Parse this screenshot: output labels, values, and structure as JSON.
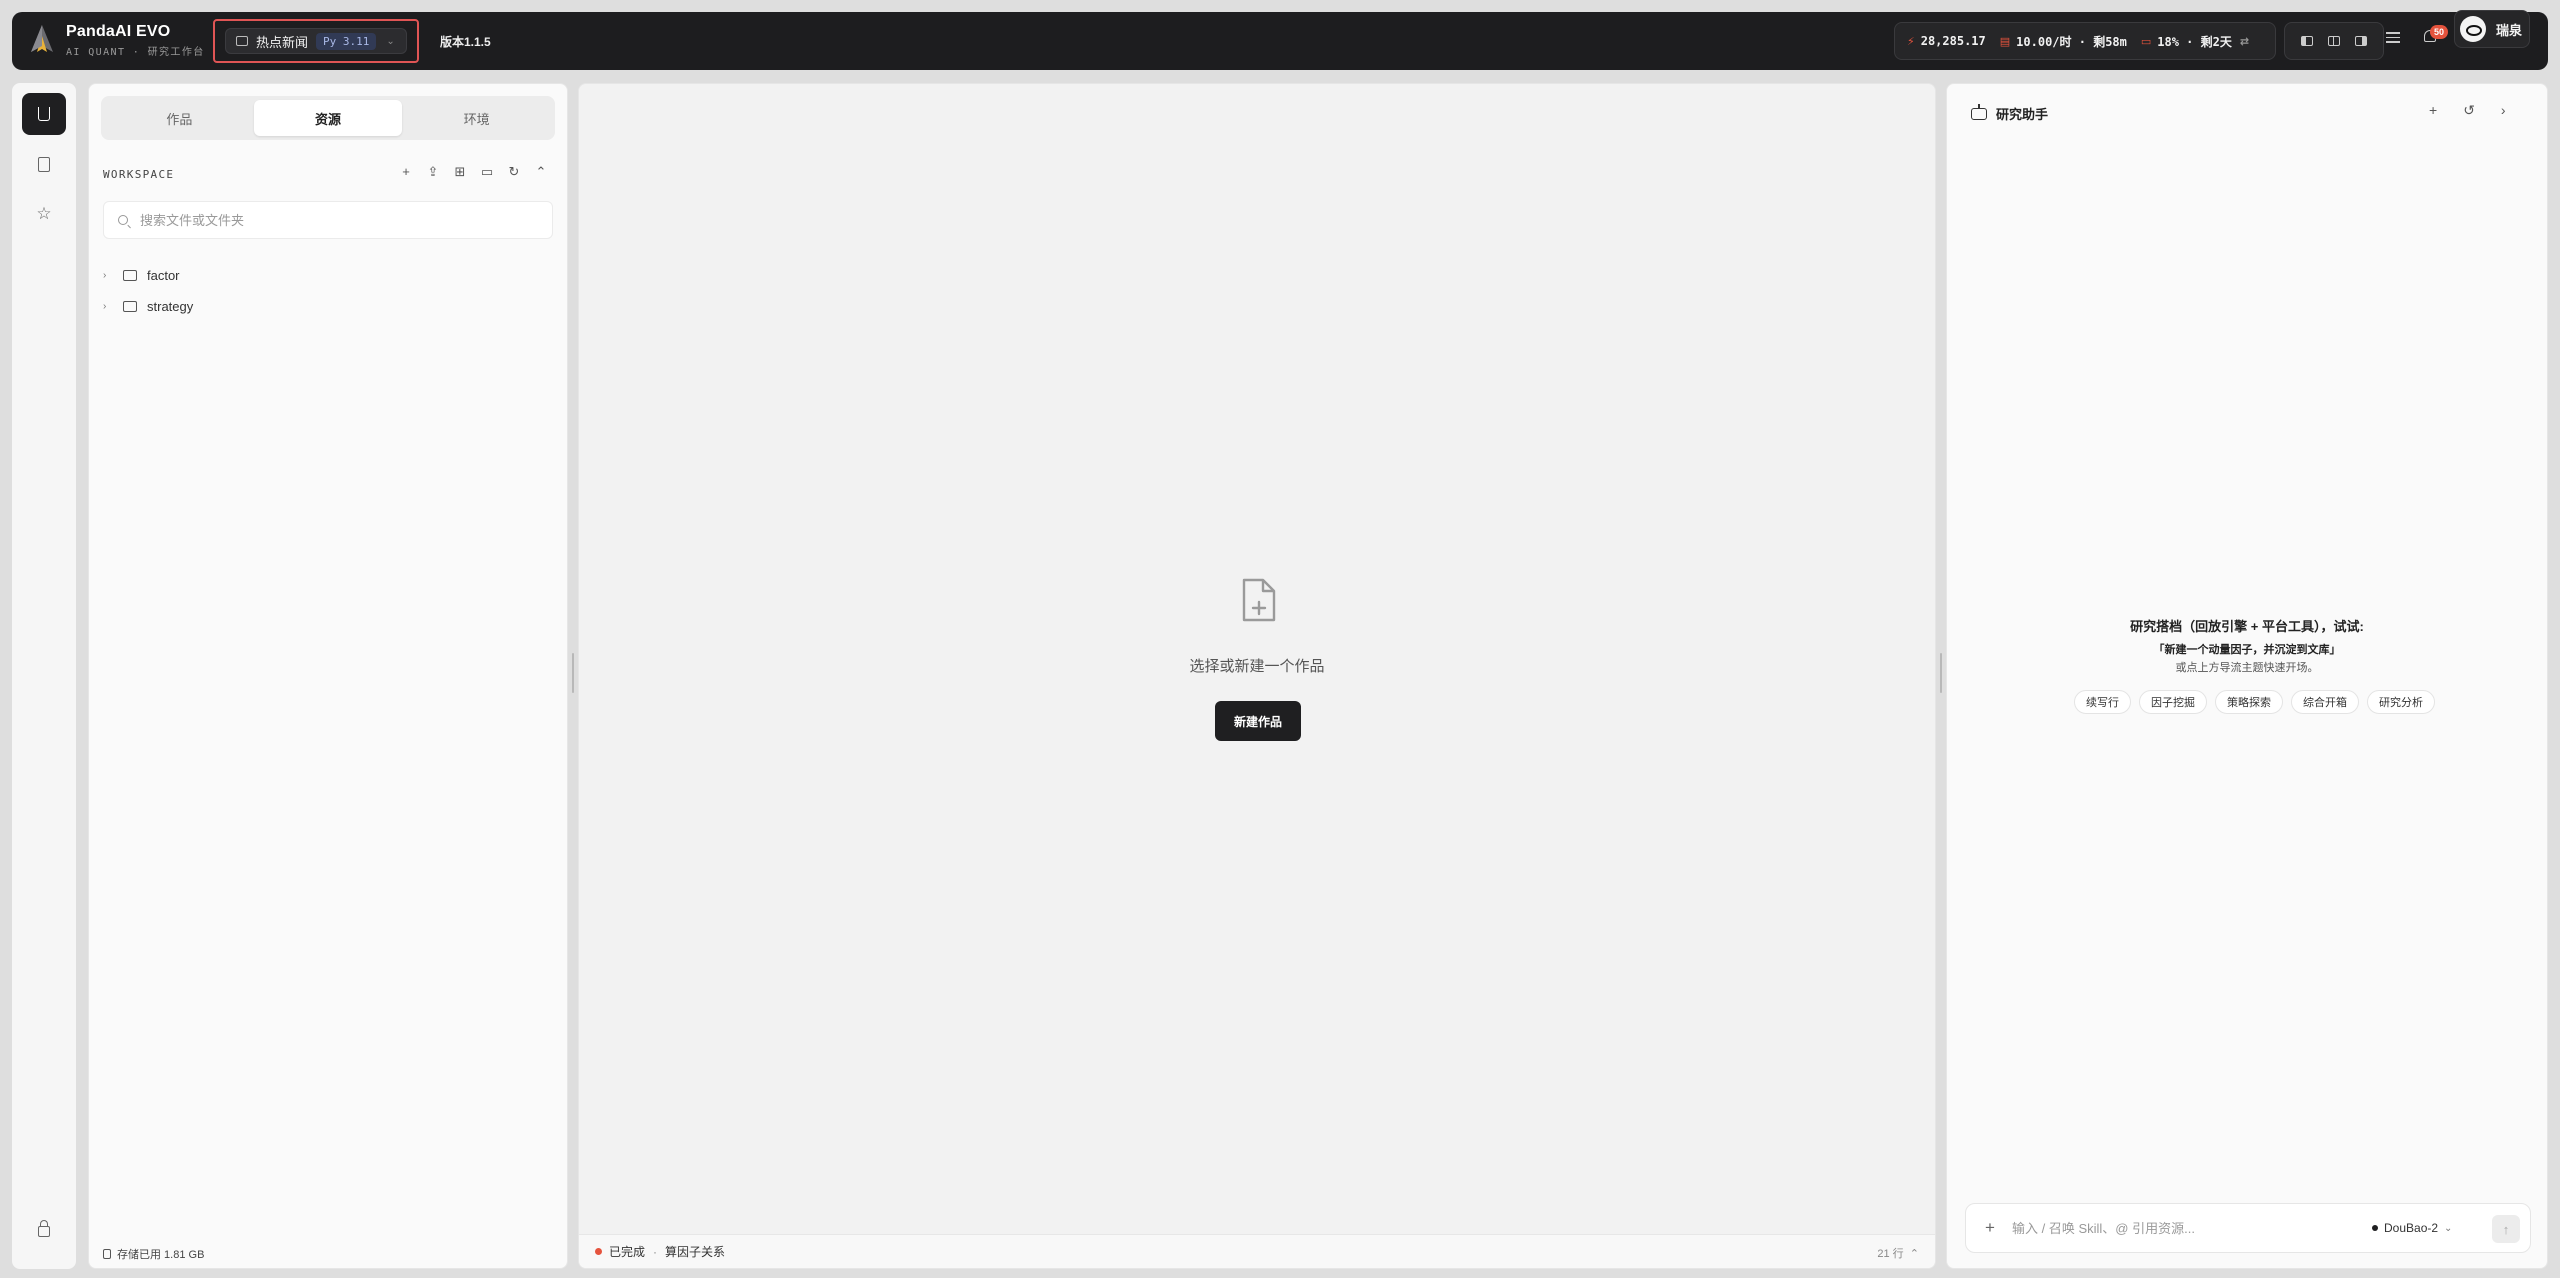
{
  "app": {
    "title": "PandaAI EVO",
    "subtitle": "AI QUANT · 研究工作台"
  },
  "project": {
    "name": "热点新闻",
    "python": "Py 3.11"
  },
  "version": "版本1.1.5",
  "stats": {
    "points": "28,285.17",
    "rate": "10.00/时 · 剩58m",
    "quota": "18% · 剩2天"
  },
  "notifications": {
    "count": "50"
  },
  "user": {
    "name": "瑞泉"
  },
  "rail": {
    "items": [
      {
        "icon": "flask-icon"
      },
      {
        "icon": "book-icon"
      },
      {
        "icon": "star-icon"
      }
    ],
    "bottom_icon": "lock-icon"
  },
  "explorer": {
    "tabs": [
      "作品",
      "资源",
      "环境"
    ],
    "active_tab": "资源",
    "section_label": "WORKSPACE",
    "search_placeholder": "搜索文件或文件夹",
    "tree": [
      {
        "name": "factor"
      },
      {
        "name": "strategy"
      }
    ],
    "storage": "存储已用 1.81 GB"
  },
  "center": {
    "empty_text": "选择或新建一个作品",
    "new_button": "新建作品",
    "status": {
      "state": "已完成",
      "task": "算因子关系",
      "lines": "21 行"
    },
    "status_color": "#e5533d"
  },
  "assistant": {
    "title": "研究助手",
    "intro_title": "研究搭档（回放引擎 + 平台工具），试试:",
    "example": "「新建一个动量因子，并沉淀到文库」",
    "hint": "或点上方导流主题快速开场。",
    "chips": [
      "续写行",
      "因子挖掘",
      "策略探索",
      "综合开箱",
      "研究分析"
    ],
    "input_placeholder": "输入 / 召唤 Skill、@ 引用资源...",
    "model": "DouBao-2"
  },
  "colors": {
    "topbar": "#1d1d1f",
    "accent_dark": "#1f1f21",
    "badge": "#e5533d",
    "highlight_border": "#e05555"
  }
}
